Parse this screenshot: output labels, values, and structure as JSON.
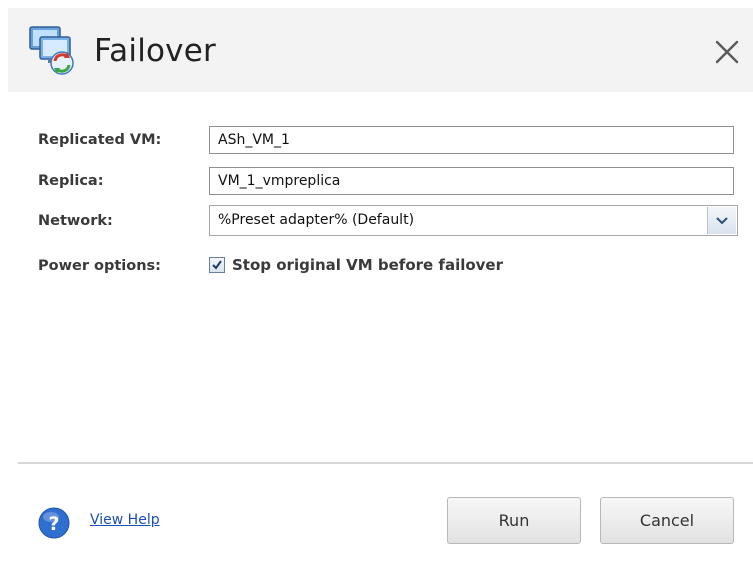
{
  "dialog": {
    "title": "Failover",
    "title_icon": "vm-failover-icon",
    "close_icon": "close-icon"
  },
  "form": {
    "replicated_vm": {
      "label": "Replicated VM:",
      "value": "ASh_VM_1"
    },
    "replica": {
      "label": "Replica:",
      "value": "VM_1_vmpreplica"
    },
    "network": {
      "label": "Network:",
      "value": "%Preset adapter% (Default)"
    },
    "power_options": {
      "label": "Power options:",
      "checkbox_label": "Stop original VM before failover",
      "checked": true
    }
  },
  "footer": {
    "help_link": "View Help",
    "run_button": "Run",
    "cancel_button": "Cancel"
  },
  "colors": {
    "link": "#1b4fb3",
    "title_bar_bg": "#f3f3f3",
    "help_icon": "#2f6fd0"
  }
}
